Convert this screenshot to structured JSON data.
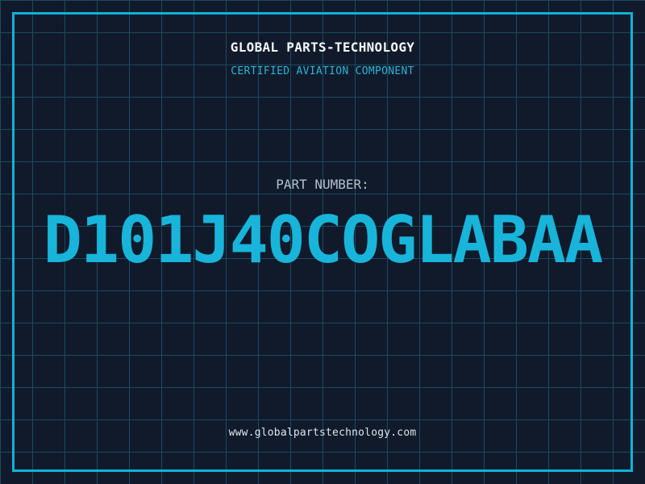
{
  "header": {
    "company_name": "GLOBAL PARTS-TECHNOLOGY",
    "subtitle": "CERTIFIED AVIATION COMPONENT"
  },
  "part": {
    "label": "PART NUMBER:",
    "number": "D101J40COGLABAA"
  },
  "footer": {
    "website": "www.globalpartstechnology.com"
  },
  "colors": {
    "background": "#101a2b",
    "grid_line": "#1b4a5f",
    "frame_border": "#0fb2d8",
    "part_number_cyan": "#18b4da",
    "subtitle_cyan": "#2bb3d6",
    "company_white": "#f4f6f8",
    "label_gray": "#b4c1ce",
    "footer_white": "#dde6ec"
  }
}
